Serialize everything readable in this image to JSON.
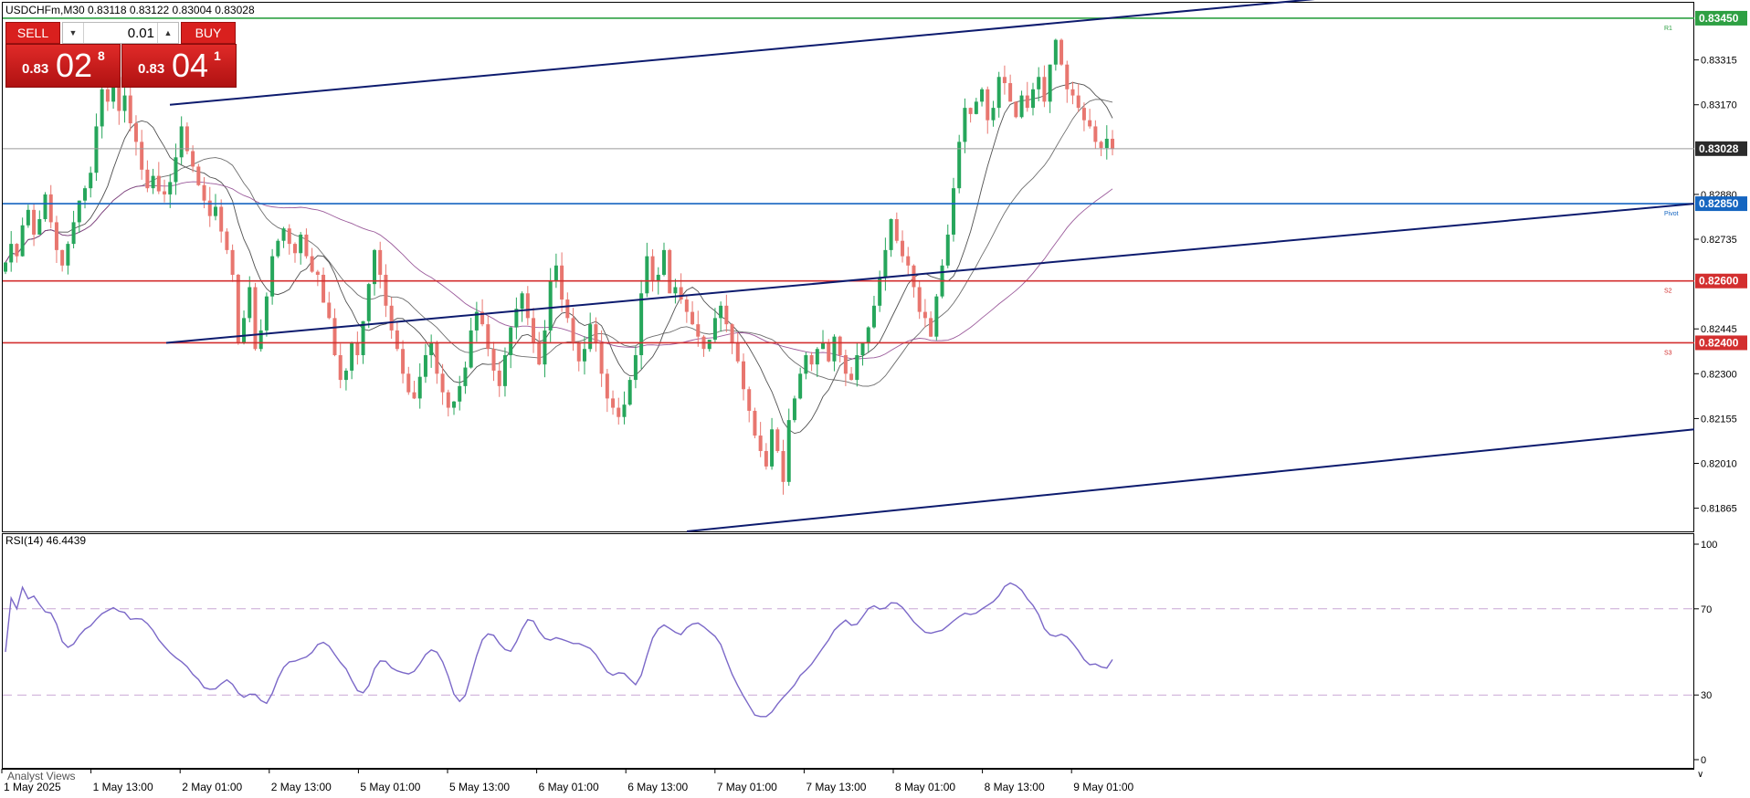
{
  "header": {
    "symbol_line": "USDCHFm,M30  0.83118 0.83122 0.83004 0.83028"
  },
  "trade_panel": {
    "sell_label": "SELL",
    "buy_label": "BUY",
    "volume": "0.01",
    "sell_price": {
      "prefix": "0.83",
      "big": "02",
      "sup": "8"
    },
    "buy_price": {
      "prefix": "0.83",
      "big": "04",
      "sup": "1"
    }
  },
  "price_axis": {
    "ticks": [
      "0.83315",
      "0.83170",
      "0.82880",
      "0.82735",
      "0.82445",
      "0.82300",
      "0.82155",
      "0.82010",
      "0.81865"
    ],
    "badges": [
      {
        "name": "r1",
        "value": "0.83450",
        "color": "#2ea043"
      },
      {
        "name": "current",
        "value": "0.83028",
        "color": "#2b2b2b"
      },
      {
        "name": "pivot",
        "value": "0.82850",
        "color": "#1565c0"
      },
      {
        "name": "s2",
        "value": "0.82600",
        "color": "#d32f2f"
      },
      {
        "name": "s3",
        "value": "0.82400",
        "color": "#d32f2f"
      }
    ]
  },
  "level_tags": {
    "r1": "R1",
    "pivot": "Pivot",
    "s2": "S2",
    "s3": "S3"
  },
  "rsi": {
    "label": "RSI(14) 46.4439",
    "ticks": [
      "100",
      "70",
      "30",
      "0"
    ]
  },
  "time_axis": {
    "labels": [
      "1 May 2025",
      "1 May 13:00",
      "2 May 01:00",
      "2 May 13:00",
      "5 May 01:00",
      "5 May 13:00",
      "6 May 01:00",
      "6 May 13:00",
      "7 May 01:00",
      "7 May 13:00",
      "8 May 01:00",
      "8 May 13:00",
      "9 May 01:00"
    ]
  },
  "footer": {
    "analyst_views": "Analyst Views"
  },
  "colors": {
    "bull": "#26a65b",
    "bear": "#e8766f",
    "rsi_line": "#7b68c8",
    "channel": "#0d1b6e",
    "r1": "#2ea043",
    "pivot": "#1565c0",
    "support": "#d32f2f"
  },
  "chart_data": {
    "type": "candlestick",
    "ylim": [
      0.8179,
      0.835
    ],
    "price_ticks": [
      0.83315,
      0.8317,
      0.8288,
      0.82735,
      0.82445,
      0.823,
      0.82155,
      0.8201,
      0.81865
    ],
    "levels": [
      {
        "name": "R1",
        "value": 0.8345,
        "color": "#2ea043"
      },
      {
        "name": "Pivot",
        "value": 0.8285,
        "color": "#1565c0"
      },
      {
        "name": "S2",
        "value": 0.826,
        "color": "#d32f2f"
      },
      {
        "name": "S3",
        "value": 0.824,
        "color": "#d32f2f"
      }
    ],
    "current_price": 0.83028,
    "close_series": [
      0.8266,
      0.8272,
      0.8268,
      0.8278,
      0.8283,
      0.8275,
      0.828,
      0.8288,
      0.8279,
      0.827,
      0.8265,
      0.8272,
      0.8279,
      0.8286,
      0.829,
      0.8295,
      0.831,
      0.8322,
      0.8318,
      0.8326,
      0.8315,
      0.832,
      0.8311,
      0.8305,
      0.8296,
      0.829,
      0.8294,
      0.8289,
      0.8288,
      0.8292,
      0.83,
      0.831,
      0.8302,
      0.8297,
      0.8291,
      0.8286,
      0.8281,
      0.8284,
      0.8276,
      0.827,
      0.8262,
      0.824,
      0.8248,
      0.8258,
      0.8238,
      0.8244,
      0.8255,
      0.8268,
      0.8273,
      0.8277,
      0.8272,
      0.8269,
      0.8275,
      0.8268,
      0.8263,
      0.8262,
      0.8253,
      0.8248,
      0.8236,
      0.8228,
      0.8231,
      0.824,
      0.8236,
      0.8247,
      0.8259,
      0.827,
      0.8262,
      0.8252,
      0.8244,
      0.8238,
      0.823,
      0.8224,
      0.8222,
      0.8229,
      0.8236,
      0.824,
      0.823,
      0.8224,
      0.8219,
      0.8221,
      0.8226,
      0.8232,
      0.8244,
      0.825,
      0.8246,
      0.8238,
      0.8231,
      0.8226,
      0.8236,
      0.8245,
      0.8251,
      0.8256,
      0.8248,
      0.824,
      0.8233,
      0.8244,
      0.826,
      0.8265,
      0.8254,
      0.8248,
      0.824,
      0.8234,
      0.8238,
      0.8246,
      0.824,
      0.823,
      0.8222,
      0.8219,
      0.8216,
      0.822,
      0.8228,
      0.8236,
      0.8256,
      0.8268,
      0.826,
      0.8262,
      0.827,
      0.8256,
      0.8258,
      0.8254,
      0.825,
      0.8246,
      0.8242,
      0.8238,
      0.8241,
      0.8248,
      0.8252,
      0.8246,
      0.824,
      0.8234,
      0.8225,
      0.8218,
      0.821,
      0.8205,
      0.82,
      0.8212,
      0.8205,
      0.8195,
      0.8215,
      0.8222,
      0.823,
      0.8236,
      0.8233,
      0.8238,
      0.824,
      0.8234,
      0.8242,
      0.8236,
      0.823,
      0.8228,
      0.8236,
      0.824,
      0.8245,
      0.8252,
      0.8261,
      0.827,
      0.828,
      0.8273,
      0.8268,
      0.8265,
      0.8258,
      0.825,
      0.8248,
      0.8242,
      0.8255,
      0.8265,
      0.8275,
      0.829,
      0.8305,
      0.8316,
      0.8314,
      0.8318,
      0.8322,
      0.8312,
      0.8316,
      0.8326,
      0.8324,
      0.8318,
      0.8313,
      0.832,
      0.8316,
      0.8322,
      0.8326,
      0.8318,
      0.833,
      0.8338,
      0.833,
      0.8322,
      0.832,
      0.8316,
      0.8312,
      0.831,
      0.8305,
      0.8303,
      0.8306,
      0.83028
    ],
    "rsi": {
      "value": 46.4439,
      "levels": [
        70,
        30
      ],
      "ylim": [
        0,
        100
      ]
    },
    "channel": {
      "upper": [
        [
          0.8317,
          0.8352
        ],
        [
          0.8317,
          0.8345
        ]
      ],
      "middle_from": 0.824,
      "middle_to": 0.8285,
      "lower_from": 0.8179,
      "lower_to": 0.8212
    }
  }
}
